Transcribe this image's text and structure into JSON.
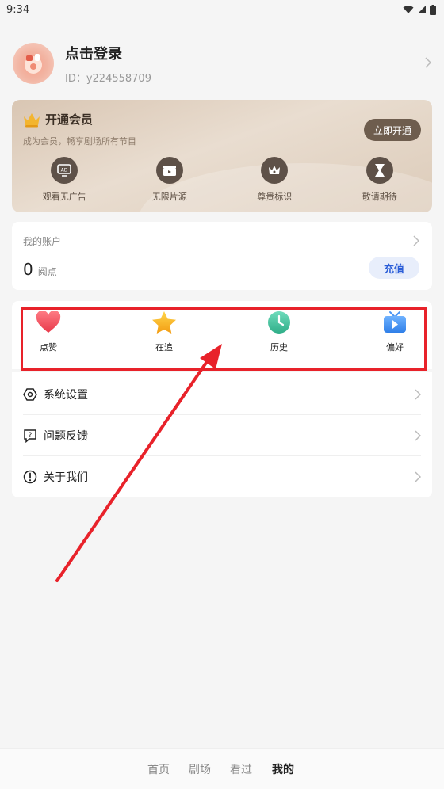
{
  "status_bar": {
    "time": "9:34"
  },
  "profile": {
    "title": "点击登录",
    "user_id": "ID：y224558709"
  },
  "vip": {
    "title": "开通会员",
    "subtitle": "成为会员，畅享剧场所有节目",
    "button": "立即开通",
    "perks": [
      {
        "label": "观看无广告",
        "icon": "ad-free-icon"
      },
      {
        "label": "无限片源",
        "icon": "film-clapper-icon"
      },
      {
        "label": "尊贵标识",
        "icon": "crown-badge-icon"
      },
      {
        "label": "敬请期待",
        "icon": "hourglass-icon"
      }
    ]
  },
  "account": {
    "title": "我的账户",
    "balance": "0",
    "unit": "阅点",
    "recharge": "充值"
  },
  "shortcuts": [
    {
      "label": "点赞",
      "icon": "heart-icon",
      "color": "#ef4e5b"
    },
    {
      "label": "在追",
      "icon": "star-icon",
      "color": "#f6b21d"
    },
    {
      "label": "历史",
      "icon": "clock-icon",
      "color": "#3fbf9c"
    },
    {
      "label": "偏好",
      "icon": "tv-icon",
      "color": "#3d8ef5"
    }
  ],
  "settings": [
    {
      "label": "系统设置",
      "icon": "hexagon-settings-icon"
    },
    {
      "label": "问题反馈",
      "icon": "feedback-question-icon"
    },
    {
      "label": "关于我们",
      "icon": "info-circle-icon"
    }
  ],
  "tabbar": {
    "tabs": [
      "首页",
      "剧场",
      "看过",
      "我的"
    ],
    "active": "我的"
  },
  "colors": {
    "highlight": "#e8222a",
    "recharge_text": "#2b5ed8",
    "vip_button": "#6e5d4e"
  }
}
